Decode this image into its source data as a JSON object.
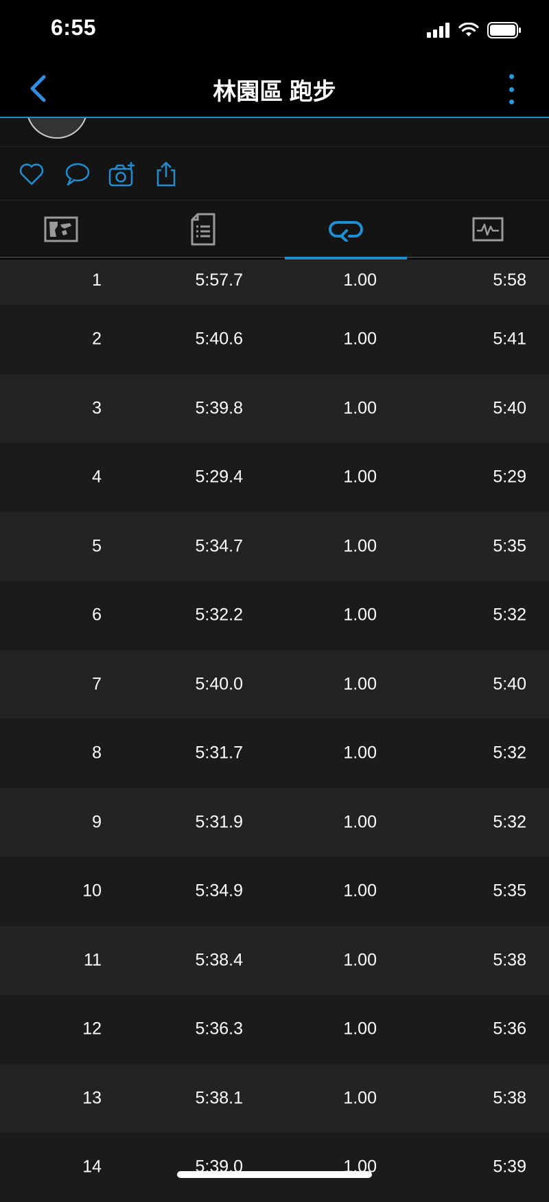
{
  "status": {
    "time": "6:55"
  },
  "nav": {
    "title": "林園區 跑步",
    "back_icon": "chevron-left-icon",
    "more_icon": "more-vertical-icon"
  },
  "actions": [
    {
      "icon": "heart-icon"
    },
    {
      "icon": "comment-icon"
    },
    {
      "icon": "camera-add-icon"
    },
    {
      "icon": "share-icon"
    }
  ],
  "tabs": [
    {
      "icon": "map-icon",
      "active": false
    },
    {
      "icon": "details-icon",
      "active": false
    },
    {
      "icon": "laps-icon",
      "active": true
    },
    {
      "icon": "chart-icon",
      "active": false
    }
  ],
  "colors": {
    "accent": "#1f8fd3",
    "background": "#000000",
    "row_odd": "#232323",
    "row_even": "#1b1b1b"
  },
  "laps": [
    {
      "lap": "1",
      "time": "5:57.7",
      "distance": "1.00",
      "pace": "5:58"
    },
    {
      "lap": "2",
      "time": "5:40.6",
      "distance": "1.00",
      "pace": "5:41"
    },
    {
      "lap": "3",
      "time": "5:39.8",
      "distance": "1.00",
      "pace": "5:40"
    },
    {
      "lap": "4",
      "time": "5:29.4",
      "distance": "1.00",
      "pace": "5:29"
    },
    {
      "lap": "5",
      "time": "5:34.7",
      "distance": "1.00",
      "pace": "5:35"
    },
    {
      "lap": "6",
      "time": "5:32.2",
      "distance": "1.00",
      "pace": "5:32"
    },
    {
      "lap": "7",
      "time": "5:40.0",
      "distance": "1.00",
      "pace": "5:40"
    },
    {
      "lap": "8",
      "time": "5:31.7",
      "distance": "1.00",
      "pace": "5:32"
    },
    {
      "lap": "9",
      "time": "5:31.9",
      "distance": "1.00",
      "pace": "5:32"
    },
    {
      "lap": "10",
      "time": "5:34.9",
      "distance": "1.00",
      "pace": "5:35"
    },
    {
      "lap": "11",
      "time": "5:38.4",
      "distance": "1.00",
      "pace": "5:38"
    },
    {
      "lap": "12",
      "time": "5:36.3",
      "distance": "1.00",
      "pace": "5:36"
    },
    {
      "lap": "13",
      "time": "5:38.1",
      "distance": "1.00",
      "pace": "5:38"
    },
    {
      "lap": "14",
      "time": "5:39.0",
      "distance": "1.00",
      "pace": "5:39"
    }
  ]
}
